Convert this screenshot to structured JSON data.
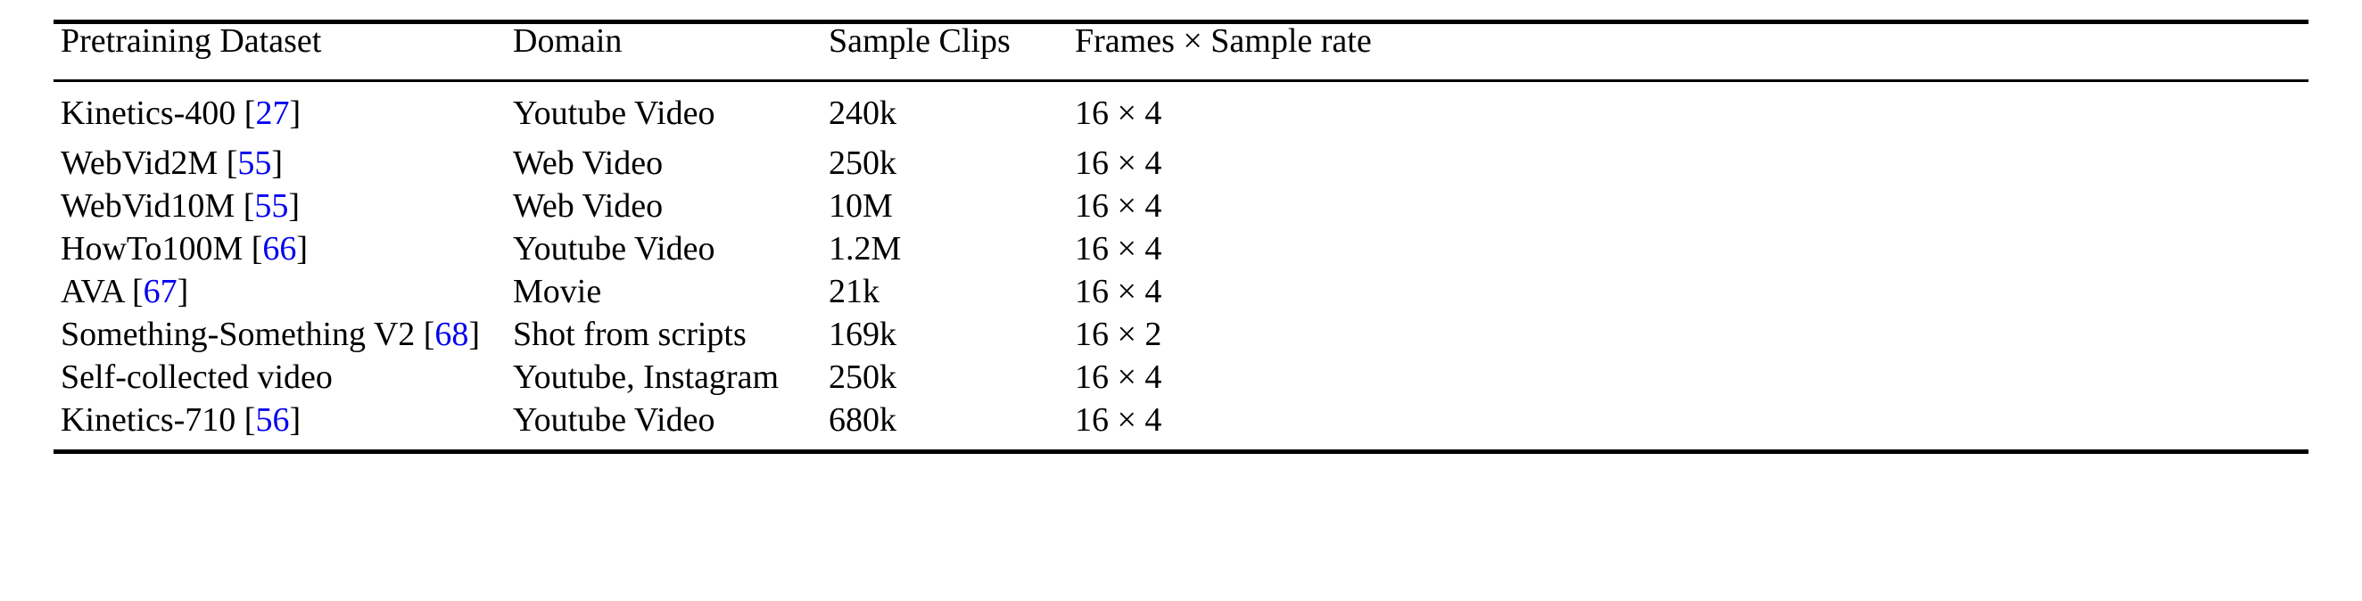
{
  "table": {
    "caption": "",
    "headers": [
      "Pretraining Dataset",
      "Domain",
      "Sample Clips",
      "Frames × Sample rate"
    ],
    "rows": [
      {
        "dataset_name": "Kinetics-400",
        "citation_open": "[",
        "citation_num": "27",
        "citation_close": "]",
        "domain": "Youtube Video",
        "sample_clips": "240k",
        "frames_rate": "16 × 4"
      },
      {
        "dataset_name": "WebVid2M",
        "citation_open": "[",
        "citation_num": "55",
        "citation_close": "]",
        "domain": "Web Video",
        "sample_clips": "250k",
        "frames_rate": "16 × 4"
      },
      {
        "dataset_name": "WebVid10M",
        "citation_open": "[",
        "citation_num": "55",
        "citation_close": "]",
        "domain": "Web Video",
        "sample_clips": "10M",
        "frames_rate": "16 × 4"
      },
      {
        "dataset_name": "HowTo100M",
        "citation_open": "[",
        "citation_num": "66",
        "citation_close": "]",
        "domain": "Youtube Video",
        "sample_clips": "1.2M",
        "frames_rate": "16 × 4"
      },
      {
        "dataset_name": "AVA",
        "citation_open": "[",
        "citation_num": "67",
        "citation_close": "]",
        "domain": "Movie",
        "sample_clips": "21k",
        "frames_rate": "16 × 4"
      },
      {
        "dataset_name": "Something-Something V2",
        "citation_open": "[",
        "citation_num": "68",
        "citation_close": "]",
        "domain": "Shot from scripts",
        "sample_clips": "169k",
        "frames_rate": "16 × 2"
      },
      {
        "dataset_name": "Self-collected video",
        "citation_open": "",
        "citation_num": "",
        "citation_close": "",
        "domain": "Youtube, Instagram",
        "sample_clips": "250k",
        "frames_rate": "16 × 4"
      },
      {
        "dataset_name": "Kinetics-710",
        "citation_open": "[",
        "citation_num": "56",
        "citation_close": "]",
        "domain": "Youtube Video",
        "sample_clips": "680k",
        "frames_rate": "16 × 4"
      }
    ]
  },
  "colors": {
    "text": "#000000",
    "citation_link": "#0000ee",
    "rule": "#000000",
    "background": "#ffffff"
  }
}
